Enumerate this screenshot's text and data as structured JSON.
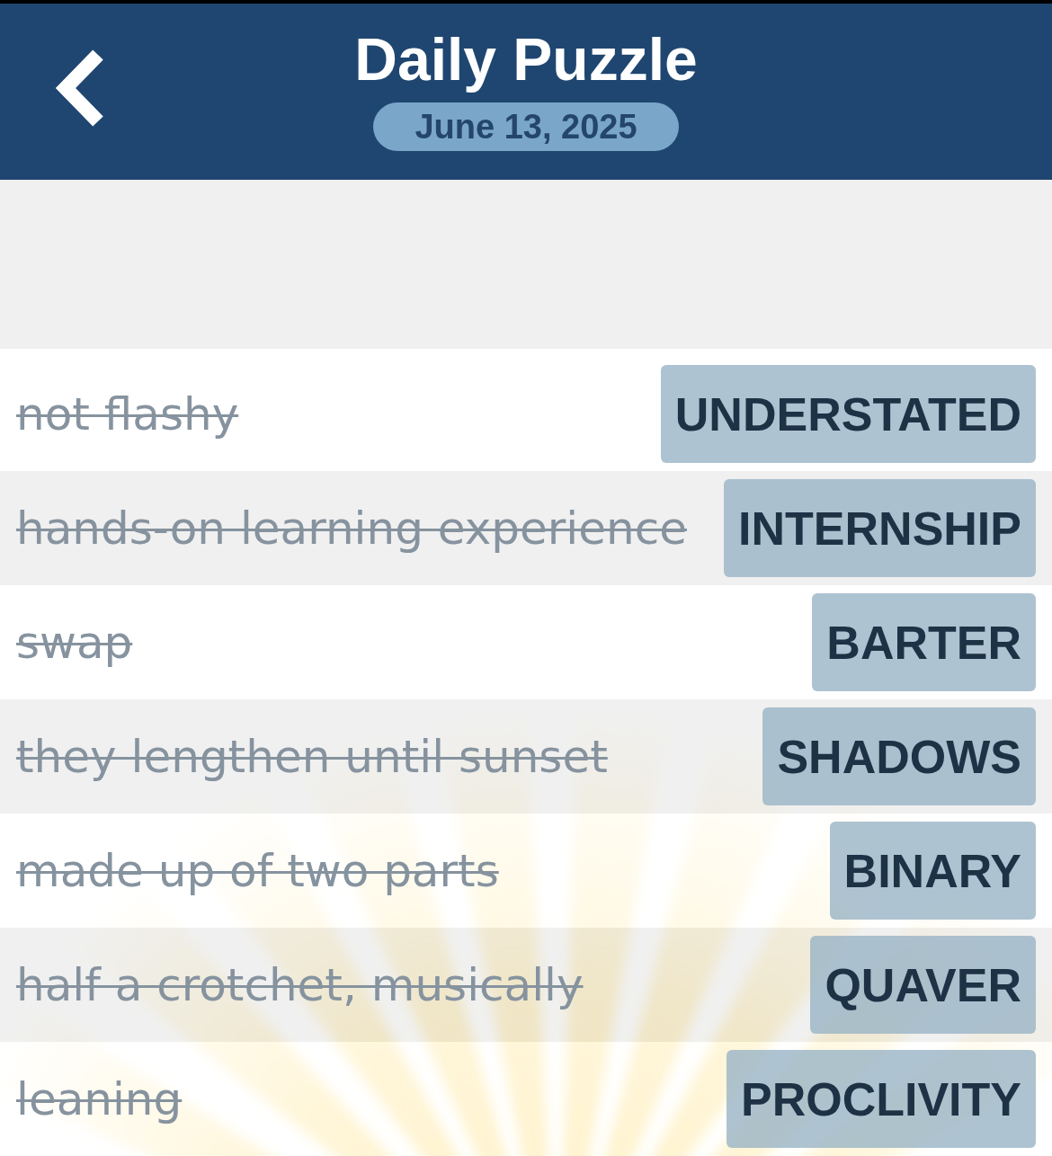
{
  "header": {
    "title": "Daily Puzzle",
    "date": "June 13, 2025"
  },
  "clues": [
    {
      "clue": "not flashy",
      "answer": "UNDERSTATED",
      "solved": true
    },
    {
      "clue": "hands-on learning experience",
      "answer": "INTERNSHIP",
      "solved": true
    },
    {
      "clue": "swap",
      "answer": "BARTER",
      "solved": true
    },
    {
      "clue": "they lengthen until sunset",
      "answer": "SHADOWS",
      "solved": true
    },
    {
      "clue": "made up of two parts",
      "answer": "BINARY",
      "solved": true
    },
    {
      "clue": "half a crotchet, musically",
      "answer": "QUAVER",
      "solved": true
    },
    {
      "clue": "leaning",
      "answer": "PROCLIVITY",
      "solved": true
    }
  ]
}
